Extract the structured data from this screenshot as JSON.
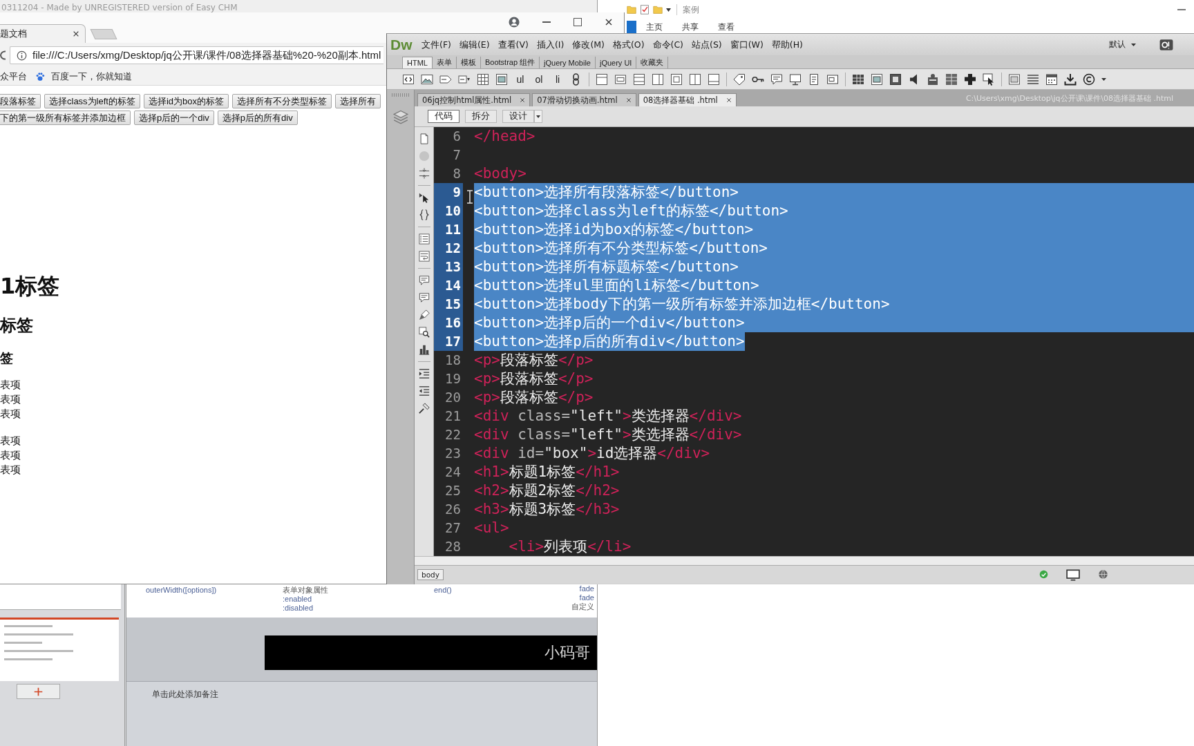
{
  "help_window": {
    "title": "0311204 - Made by UNREGISTERED version of Easy CHM"
  },
  "file_explorer": {
    "title": "案例",
    "ribbon_tabs": [
      "主页",
      "共享",
      "查看"
    ]
  },
  "presentation": {
    "slide_columns": [
      [
        {
          "kind": "method",
          "text": "outerWidth([options])"
        }
      ],
      [
        {
          "kind": "heading",
          "text": "表单对象属性"
        },
        {
          "kind": "method",
          "text": ":enabled"
        },
        {
          "kind": "method",
          "text": ":disabled"
        }
      ],
      [
        {
          "kind": "method",
          "text": "end()"
        }
      ],
      [
        {
          "kind": "method",
          "text": "fade"
        },
        {
          "kind": "method",
          "text": "fade"
        },
        {
          "kind": "heading",
          "text": "自定义"
        }
      ]
    ],
    "banner_text": "小码哥",
    "notes_placeholder": "单击此处添加备注"
  },
  "browser": {
    "tabs": [
      {
        "title": "题文档",
        "selected": true
      }
    ],
    "address": "file:///C:/Users/xmg/Desktop/jq公开课/课件/08选择器基础%20-%20副本.html",
    "bookmarks": [
      {
        "kind": "plain",
        "label": "众平台"
      },
      {
        "kind": "paw",
        "label": "百度一下，你就知道"
      }
    ],
    "page": {
      "button_rows": [
        [
          "段落标签",
          "选择class为left的标签",
          "选择id为box的标签",
          "选择所有不分类型标签",
          "选择所有"
        ],
        [
          "下的第一级所有标签并添加边框",
          "选择p后的一个div",
          "选择p后的所有div"
        ]
      ],
      "headings": [
        {
          "kind": "h1",
          "text": "1标签"
        },
        {
          "kind": "h2",
          "text": "标签"
        },
        {
          "kind": "h3",
          "text": "签"
        }
      ],
      "lists": [
        [
          "表项",
          "表项",
          "表项"
        ],
        [
          "表项",
          "表项",
          "表项"
        ]
      ]
    }
  },
  "editor": {
    "logo": "Dw",
    "menu": [
      "文件(F)",
      "编辑(E)",
      "查看(V)",
      "插入(I)",
      "修改(M)",
      "格式(O)",
      "命令(C)",
      "站点(S)",
      "窗口(W)",
      "帮助(H)"
    ],
    "workspace": "默认",
    "insert_tabs": [
      {
        "label": "HTML",
        "selected": true
      },
      {
        "label": "表单",
        "selected": false
      },
      {
        "label": "模板",
        "selected": false
      },
      {
        "label": "Bootstrap 组件",
        "selected": false
      },
      {
        "label": "jQuery Mobile",
        "selected": false
      },
      {
        "label": "jQuery UI",
        "selected": false
      },
      {
        "label": "收藏夹",
        "selected": false
      }
    ],
    "insert_text_buttons": [
      "ul",
      "ol",
      "li"
    ],
    "documents": [
      {
        "title": "06jq控制html属性.html",
        "selected": false
      },
      {
        "title": "07滑动切换动画.html",
        "selected": false
      },
      {
        "title": "08选择器基础 .html",
        "selected": true
      }
    ],
    "file_path": "C:\\Users\\xmg\\Desktop\\jq公开课\\课件\\08选择器基础 .html",
    "views": [
      {
        "label": "代码",
        "selected": true
      },
      {
        "label": "拆分",
        "selected": false
      },
      {
        "label": "设计",
        "selected": false
      }
    ],
    "code_lines": [
      {
        "number": "6",
        "selected": false,
        "tokens": [
          {
            "kind": "tag",
            "text": "</head>"
          }
        ]
      },
      {
        "number": "7",
        "selected": false
      },
      {
        "number": "8",
        "selected": false,
        "tokens": [
          {
            "kind": "tag",
            "text": "<body>"
          }
        ]
      },
      {
        "number": "9",
        "selected": true,
        "tokens": [
          {
            "kind": "tag",
            "text": "<button>"
          },
          {
            "kind": "text",
            "text": "选择所有段落标签"
          },
          {
            "kind": "tag",
            "text": "</button>"
          }
        ]
      },
      {
        "number": "10",
        "selected": true,
        "tokens": [
          {
            "kind": "tag",
            "text": "<button>"
          },
          {
            "kind": "text",
            "text": "选择class为left的标签"
          },
          {
            "kind": "tag",
            "text": "</button>"
          }
        ]
      },
      {
        "number": "11",
        "selected": true,
        "tokens": [
          {
            "kind": "tag",
            "text": "<button>"
          },
          {
            "kind": "text",
            "text": "选择id为box的标签"
          },
          {
            "kind": "tag",
            "text": "</button>"
          }
        ]
      },
      {
        "number": "12",
        "selected": true,
        "tokens": [
          {
            "kind": "tag",
            "text": "<button>"
          },
          {
            "kind": "text",
            "text": "选择所有不分类型标签"
          },
          {
            "kind": "tag",
            "text": "</button>"
          }
        ]
      },
      {
        "number": "13",
        "selected": true,
        "tokens": [
          {
            "kind": "tag",
            "text": "<button>"
          },
          {
            "kind": "text",
            "text": "选择所有标题标签"
          },
          {
            "kind": "tag",
            "text": "</button>"
          }
        ]
      },
      {
        "number": "14",
        "selected": true,
        "tokens": [
          {
            "kind": "tag",
            "text": "<button>"
          },
          {
            "kind": "text",
            "text": "选择ul里面的li标签"
          },
          {
            "kind": "tag",
            "text": "</button>"
          }
        ]
      },
      {
        "number": "15",
        "selected": true,
        "tokens": [
          {
            "kind": "tag",
            "text": "<button>"
          },
          {
            "kind": "text",
            "text": "选择body下的第一级所有标签并添加边框"
          },
          {
            "kind": "tag",
            "text": "</button>"
          }
        ]
      },
      {
        "number": "16",
        "selected": true,
        "tokens": [
          {
            "kind": "tag",
            "text": "<button>"
          },
          {
            "kind": "text",
            "text": "选择p后的一个div"
          },
          {
            "kind": "tag",
            "text": "</button>"
          }
        ]
      },
      {
        "number": "17",
        "selected": true,
        "tokens": [
          {
            "kind": "tag",
            "text": "<button>"
          },
          {
            "kind": "text",
            "text": "选择p后的所有div"
          },
          {
            "kind": "tag",
            "text": "</button>"
          }
        ]
      },
      {
        "number": "18",
        "selected": false,
        "tokens": [
          {
            "kind": "tag",
            "text": "<p>"
          },
          {
            "kind": "text",
            "text": "段落标签"
          },
          {
            "kind": "tag",
            "text": "</p>"
          }
        ]
      },
      {
        "number": "19",
        "selected": false,
        "tokens": [
          {
            "kind": "tag",
            "text": "<p>"
          },
          {
            "kind": "text",
            "text": "段落标签"
          },
          {
            "kind": "tag",
            "text": "</p>"
          }
        ]
      },
      {
        "number": "20",
        "selected": false,
        "tokens": [
          {
            "kind": "tag",
            "text": "<p>"
          },
          {
            "kind": "text",
            "text": "段落标签"
          },
          {
            "kind": "tag",
            "text": "</p>"
          }
        ]
      },
      {
        "number": "21",
        "selected": false,
        "tokens": [
          {
            "kind": "tag",
            "text": "<div"
          },
          {
            "kind": "attr",
            "text": " class="
          },
          {
            "kind": "value",
            "text": "\"left\""
          },
          {
            "kind": "tag",
            "text": ">"
          },
          {
            "kind": "text",
            "text": "类选择器"
          },
          {
            "kind": "tag",
            "text": "</div>"
          }
        ]
      },
      {
        "number": "22",
        "selected": false,
        "tokens": [
          {
            "kind": "tag",
            "text": "<div"
          },
          {
            "kind": "attr",
            "text": " class="
          },
          {
            "kind": "value",
            "text": "\"left\""
          },
          {
            "kind": "tag",
            "text": ">"
          },
          {
            "kind": "text",
            "text": "类选择器"
          },
          {
            "kind": "tag",
            "text": "</div>"
          }
        ]
      },
      {
        "number": "23",
        "selected": false,
        "tokens": [
          {
            "kind": "tag",
            "text": "<div"
          },
          {
            "kind": "attr",
            "text": " id="
          },
          {
            "kind": "value",
            "text": "\"box\""
          },
          {
            "kind": "tag",
            "text": ">"
          },
          {
            "kind": "text",
            "text": "id选择器"
          },
          {
            "kind": "tag",
            "text": "</div>"
          }
        ]
      },
      {
        "number": "24",
        "selected": false,
        "tokens": [
          {
            "kind": "tag",
            "text": "<h1>"
          },
          {
            "kind": "text",
            "text": "标题1标签"
          },
          {
            "kind": "tag",
            "text": "</h1>"
          }
        ]
      },
      {
        "number": "25",
        "selected": false,
        "tokens": [
          {
            "kind": "tag",
            "text": "<h2>"
          },
          {
            "kind": "text",
            "text": "标题2标签"
          },
          {
            "kind": "tag",
            "text": "</h2>"
          }
        ]
      },
      {
        "number": "26",
        "selected": false,
        "tokens": [
          {
            "kind": "tag",
            "text": "<h3>"
          },
          {
            "kind": "text",
            "text": "标题3标签"
          },
          {
            "kind": "tag",
            "text": "</h3>"
          }
        ]
      },
      {
        "number": "27",
        "selected": false,
        "tokens": [
          {
            "kind": "tag",
            "text": "<ul>"
          }
        ]
      },
      {
        "number": "28",
        "selected": false,
        "tokens": [
          {
            "kind": "tag",
            "text": "    <li>"
          },
          {
            "kind": "text",
            "text": "列表项"
          },
          {
            "kind": "tag",
            "text": "</li>"
          }
        ]
      }
    ],
    "tag_selector": "body"
  }
}
